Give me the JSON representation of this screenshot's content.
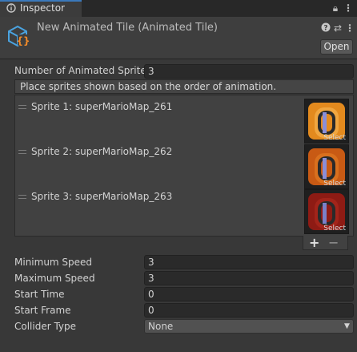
{
  "tab": {
    "title": "Inspector"
  },
  "header": {
    "title": "New Animated Tile (Animated Tile)",
    "open_label": "Open"
  },
  "icons": [
    "inspector-icon",
    "lock-icon",
    "menu-dots-icon",
    "help-icon",
    "preset-icon",
    "context-menu-icon"
  ],
  "fields": {
    "num_sprites": {
      "label": "Number of Animated Sprites",
      "value": "3"
    },
    "hint": "Place sprites shown based on the order of animation.",
    "sprites": [
      {
        "label": "Sprite 1: superMarioMap_261",
        "select": "Select",
        "color": "#e38a1e"
      },
      {
        "label": "Sprite 2: superMarioMap_262",
        "select": "Select",
        "color": "#c85a14"
      },
      {
        "label": "Sprite 3: superMarioMap_263",
        "select": "Select",
        "color": "#8e1b14"
      }
    ],
    "add_label": "+",
    "remove_label": "−",
    "min_speed": {
      "label": "Minimum Speed",
      "value": "3"
    },
    "max_speed": {
      "label": "Maximum Speed",
      "value": "3"
    },
    "start_time": {
      "label": "Start Time",
      "value": "0"
    },
    "start_frame": {
      "label": "Start Frame",
      "value": "0"
    },
    "collider": {
      "label": "Collider Type",
      "value": "None"
    }
  },
  "colors": {
    "accent": "#3a79bb",
    "background": "#383838"
  }
}
